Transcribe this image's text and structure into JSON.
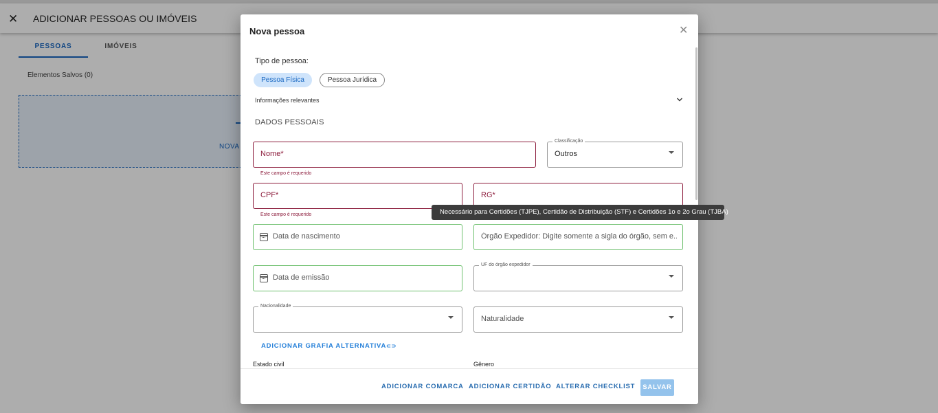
{
  "background": {
    "header": {
      "close_glyph": "✕",
      "title": "ADICIONAR PESSOAS OU IMÓVEIS"
    },
    "tabs": [
      {
        "label": "PESSOAS",
        "active": true
      },
      {
        "label": "IMÓVEIS",
        "active": false
      }
    ],
    "saved_label": "Elementos Salvos (0)",
    "dropzone_label": "NOVA P"
  },
  "dialog": {
    "title": "Nova pessoa",
    "close_glyph": "✕",
    "tipo_label": "Tipo de pessoa:",
    "chips": [
      {
        "label": "Pessoa Física",
        "selected": true
      },
      {
        "label": "Pessoa Jurídica",
        "selected": false
      }
    ],
    "info_label": "Informações relevantes",
    "section_title": "DADOS PESSOAIS",
    "fields": {
      "nome": {
        "placeholder": "Nome*",
        "helper": "Este campo é requerido"
      },
      "classificacao": {
        "legend": "Classificação",
        "value": "Outros"
      },
      "cpf": {
        "placeholder": "CPF*",
        "helper": "Este campo é requerido"
      },
      "rg": {
        "placeholder": "RG*"
      },
      "data_nascimento": {
        "placeholder": "Data de nascimento"
      },
      "orgao_expedidor": {
        "placeholder": "Órgão Expedidor: Digite somente a sigla do órgão, sem e..."
      },
      "data_emissao": {
        "placeholder": "Data de emissão"
      },
      "uf_orgao": {
        "legend": "UF do órgão expedidor"
      },
      "nacionalidade": {
        "legend": "Nacionalidade"
      },
      "naturalidade": {
        "placeholder": "Naturalidade"
      }
    },
    "alt_link": "ADICIONAR GRAFIA ALTERNATIVA",
    "link_glyph": "⊂⊃",
    "estado_civil_label": "Estado civil",
    "genero_label": "Gênero",
    "footer": {
      "comarca": "ADICIONAR COMARCA",
      "certidao": "ADICIONAR CERTIDÃO",
      "checklist": "ALTERAR CHECKLIST",
      "salvar": "SALVAR"
    }
  },
  "tooltip": "Necessário para Certidões (TJPE), Certidão de Distribuição (STF) e Certidões 1o e 2o Grau (TJBA)",
  "colors": {
    "accent": "#1565c0",
    "error": "#8b1a3a",
    "valid": "#6cbf6c",
    "chip_selected_bg": "#cfe4fb",
    "save_button": "#94c3ec"
  }
}
